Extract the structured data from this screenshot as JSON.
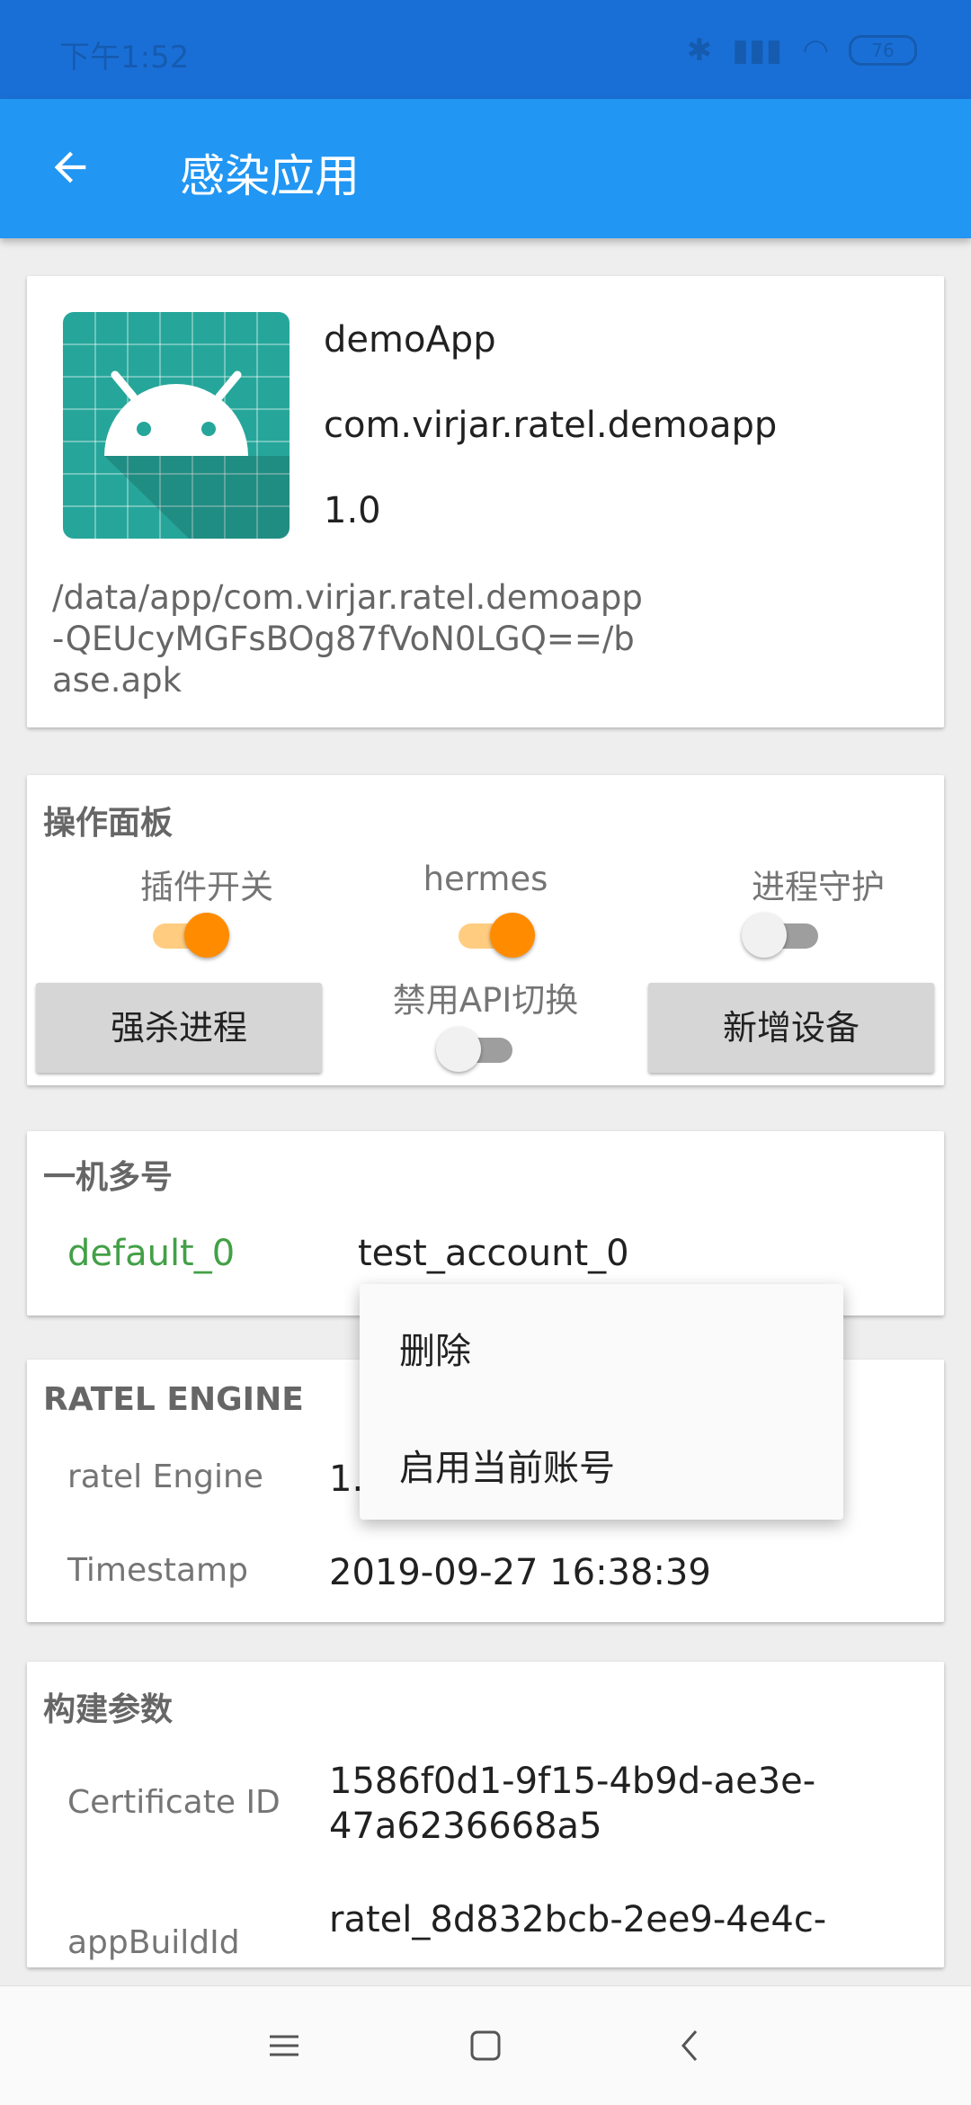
{
  "status_bar": {
    "time": "下午1:52",
    "battery": "76"
  },
  "app_bar": {
    "title": "感染应用"
  },
  "app_info": {
    "name": "demoApp",
    "package": "com.virjar.ratel.demoapp",
    "version": "1.0",
    "path": "/data/app/com.virjar.ratel.demoapp-QEUcyMGFsBOg87fVoN0LGQ==/base.apk"
  },
  "control_panel": {
    "title": "操作面板",
    "plugin_switch": {
      "label": "插件开关",
      "on": true
    },
    "hermes": {
      "label": "hermes",
      "on": true
    },
    "process_guard": {
      "label": "进程守护",
      "on": false
    },
    "disable_api": {
      "label": "禁用API切换",
      "on": false
    },
    "kill_button": "强杀进程",
    "add_device_button": "新增设备"
  },
  "multi_account": {
    "title": "一机多号",
    "default_account": "default_0",
    "current_account": "test_account_0"
  },
  "ratel_engine": {
    "title": "RATEL ENGINE",
    "engine_label": "ratel Engine",
    "engine_value": "1.",
    "timestamp_label": "Timestamp",
    "timestamp_value": "2019-09-27 16:38:39"
  },
  "build_params": {
    "title": "构建参数",
    "cert_label": "Certificate ID",
    "cert_value": "1586f0d1-9f15-4b9d-ae3e-47a6236668a5",
    "build_id_label": "appBuildId",
    "build_id_value": "ratel_8d832bcb-2ee9-4e4c-"
  },
  "context_menu": {
    "delete": "删除",
    "enable": "启用当前账号"
  },
  "colors": {
    "status_bar": "#1a6fd6",
    "app_bar": "#2196f3",
    "switch_on": "#ff8c00",
    "account_green": "#43a047"
  }
}
